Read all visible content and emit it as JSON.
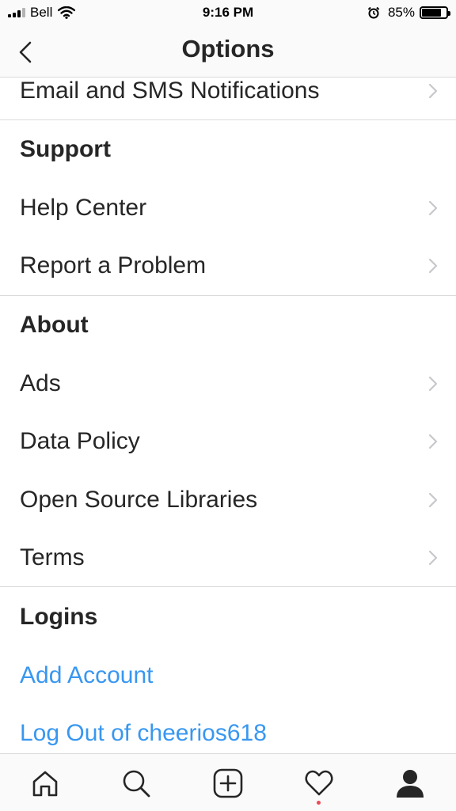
{
  "status_bar": {
    "carrier": "Bell",
    "time": "9:16 PM",
    "battery_percent": "85%",
    "battery_level": 0.85,
    "icons": [
      "signal-icon",
      "wifi-icon",
      "alarm-icon",
      "battery-icon"
    ]
  },
  "nav": {
    "title": "Options",
    "back_icon": "chevron-left-icon"
  },
  "list": {
    "email_sms": "Email and SMS Notifications",
    "support_header": "Support",
    "help_center": "Help Center",
    "report_problem": "Report a Problem",
    "about_header": "About",
    "ads": "Ads",
    "data_policy": "Data Policy",
    "open_source": "Open Source Libraries",
    "terms": "Terms",
    "logins_header": "Logins",
    "add_account": "Add Account",
    "log_out": "Log Out of cheerios618"
  },
  "tabbar": {
    "items": [
      "home-icon",
      "search-icon",
      "add-post-icon",
      "activity-heart-icon",
      "profile-icon"
    ],
    "activity_has_notification": true
  },
  "colors": {
    "text": "#262626",
    "link": "#3897f0",
    "divider": "#dbdbdb",
    "chevron": "#c7c7cc",
    "notification_dot": "#ed4956",
    "bar_background": "#fafafa"
  }
}
